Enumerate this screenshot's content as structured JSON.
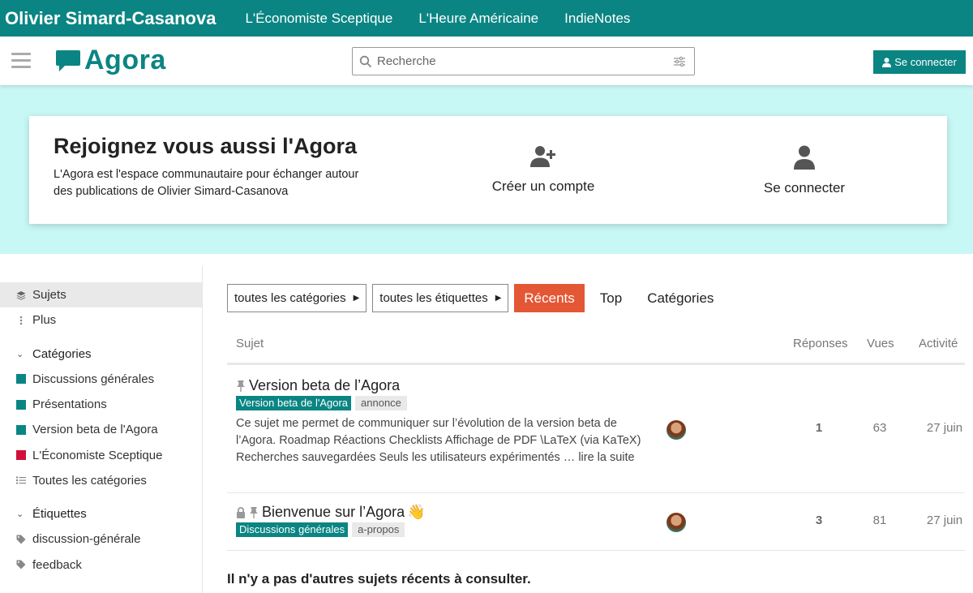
{
  "brandbar": {
    "owner": "Olivier Simard-Casanova",
    "links": [
      "L'Économiste Sceptique",
      "L'Heure Américaine",
      "IndieNotes"
    ]
  },
  "header": {
    "logo_text": "Agora",
    "search_placeholder": "Recherche",
    "login_label": "Se connecter",
    "accent_color": "#0a8583"
  },
  "hero": {
    "title": "Rejoignez vous aussi l'Agora",
    "description": "L'Agora est l'espace communautaire pour échanger autour des publications de Olivier Simard-Casanova",
    "create_account": "Créer un compte",
    "login": "Se connecter",
    "background": "#c8f8f6"
  },
  "sidebar": {
    "items": [
      {
        "label": "Sujets",
        "icon": "layers-icon"
      },
      {
        "label": "Plus",
        "icon": "vertical-dots-icon"
      }
    ],
    "categories_header": "Catégories",
    "categories": [
      {
        "label": "Discussions générales",
        "color": "#0a8583"
      },
      {
        "label": "Présentations",
        "color": "#0a8583"
      },
      {
        "label": "Version beta de l'Agora",
        "color": "#0a8583"
      },
      {
        "label": "L'Économiste Sceptique",
        "color": "#d0103a"
      }
    ],
    "all_categories": "Toutes les catégories",
    "tags_header": "Étiquettes",
    "tags": [
      "discussion-générale",
      "feedback"
    ]
  },
  "nav": {
    "categories_dropdown": "toutes les catégories",
    "tags_dropdown": "toutes les étiquettes",
    "tabs": [
      "Récents",
      "Top",
      "Catégories"
    ],
    "active_tab": "Récents"
  },
  "table": {
    "headers": {
      "subject": "Sujet",
      "replies": "Réponses",
      "views": "Vues",
      "activity": "Activité"
    },
    "rows": [
      {
        "title": "Version beta de l’Agora",
        "category": "Version beta de l'Agora",
        "tag": "annonce",
        "excerpt": "Ce sujet me permet de communiquer sur l’évolution de la version beta de l’Agora. Roadmap Réactions Checklists Affichage de PDF \\LaTeX (via KaTeX) Recherches sauvegardées Seuls les utilisateurs expérimentés … lire la suite",
        "replies": "1",
        "views": "63",
        "activity": "27 juin"
      },
      {
        "title": "Bienvenue sur l’Agora",
        "emoji": "👋",
        "category": "Discussions générales",
        "tag": "a-propos",
        "replies": "3",
        "views": "81",
        "activity": "27 juin"
      }
    ]
  },
  "footer_note": "Il n'y a pas d'autres sujets récents à consulter."
}
